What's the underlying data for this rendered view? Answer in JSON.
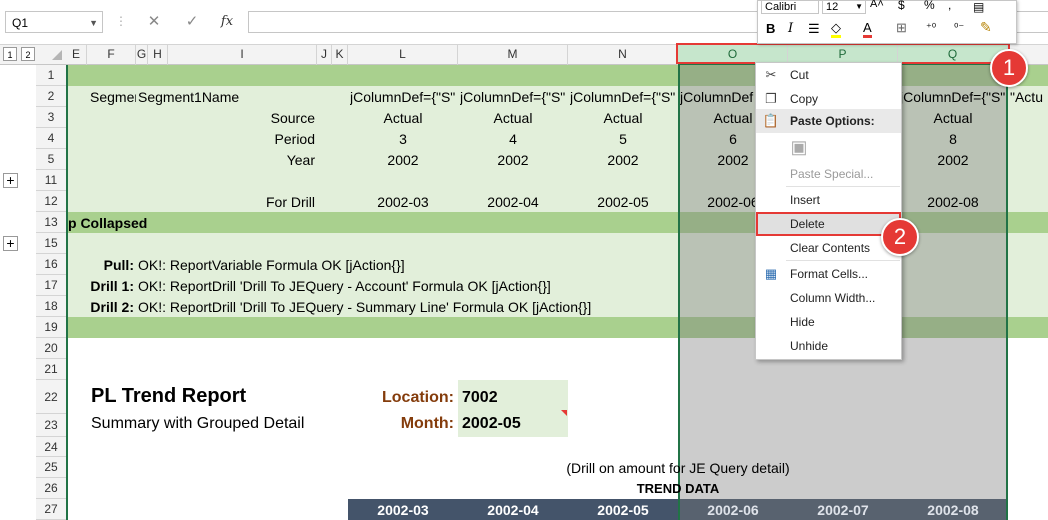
{
  "formula_bar": {
    "name_box": "Q1",
    "cancel_icon": "✕",
    "enter_icon": "✓",
    "fx_label": "fx"
  },
  "outline_levels": [
    "1",
    "2"
  ],
  "column_headers": [
    "E",
    "F",
    "G",
    "H",
    "I",
    "J",
    "K",
    "L",
    "M",
    "N",
    "O",
    "P",
    "Q"
  ],
  "row_numbers": [
    "1",
    "2",
    "3",
    "4",
    "5",
    "11",
    "12",
    "13",
    "15",
    "16",
    "17",
    "18",
    "19",
    "20",
    "21",
    "22",
    "23",
    "24",
    "25",
    "26",
    "27"
  ],
  "expand_buttons": [
    "+",
    "+"
  ],
  "row2": {
    "f": "Segmen",
    "g": "Segment1Name",
    "l": "jColumnDef={\"S\"",
    "m": "jColumnDef={\"S\"",
    "n": "jColumnDef={\"S\"",
    "o": "jColumnDef",
    "q": "jColumnDef={\"S\"",
    "r": "\"Actu"
  },
  "row3": {
    "label": "Source",
    "values": [
      "Actual",
      "Actual",
      "Actual",
      "Actual",
      "Actual"
    ]
  },
  "row4": {
    "label": "Period",
    "values": [
      "3",
      "4",
      "5",
      "6",
      "8"
    ]
  },
  "row5": {
    "label": "Year",
    "values": [
      "2002",
      "2002",
      "2002",
      "2002",
      "2002"
    ]
  },
  "row12": {
    "label": "For Drill",
    "values": [
      "2002-03",
      "2002-04",
      "2002-05",
      "2002-06",
      "2002-08"
    ]
  },
  "row13": {
    "text": "p Collapsed"
  },
  "row16": {
    "label": "Pull:",
    "text": "OK!: ReportVariable Formula OK [jAction{}]"
  },
  "row17": {
    "label": "Drill 1:",
    "text": "OK!: ReportDrill 'Drill To JEQuery - Account' Formula OK [jAction{}]"
  },
  "row18": {
    "label": "Drill 2:",
    "text": "OK!: ReportDrill 'Drill To JEQuery - Summary Line' Formula OK [jAction{}]"
  },
  "report": {
    "title": "PL Trend Report",
    "subtitle": "Summary with Grouped Detail",
    "location_label": "Location:",
    "location_value": "7002",
    "month_label": "Month:",
    "month_value": "2002-05",
    "drill_note": "(Drill on amount for JE Query detail)",
    "trend_header": "TREND DATA",
    "periods": [
      "2002-03",
      "2002-04",
      "2002-05",
      "2002-06",
      "2002-07",
      "2002-08"
    ]
  },
  "mini_toolbar": {
    "font_name": "Calibri",
    "font_size": "12",
    "dollar": "$",
    "percent": "%",
    "bold": "B",
    "italic": "I",
    "font_color_letter": "A"
  },
  "context_menu": {
    "items": [
      "Cut",
      "Copy",
      "Paste Options:",
      "Paste Special...",
      "Insert",
      "Delete",
      "Clear Contents",
      "Format Cells...",
      "Column Width...",
      "Hide",
      "Unhide"
    ]
  },
  "callouts": [
    "1",
    "2"
  ],
  "colors": {
    "grid_green": "#e2efda",
    "band_green": "#a9d08e",
    "selection_gray": "#c9c9c9",
    "trend_header": "#44546a",
    "callout_red": "#e53935",
    "highlight_red": "#e53935",
    "label_brown": "#843c0c"
  }
}
